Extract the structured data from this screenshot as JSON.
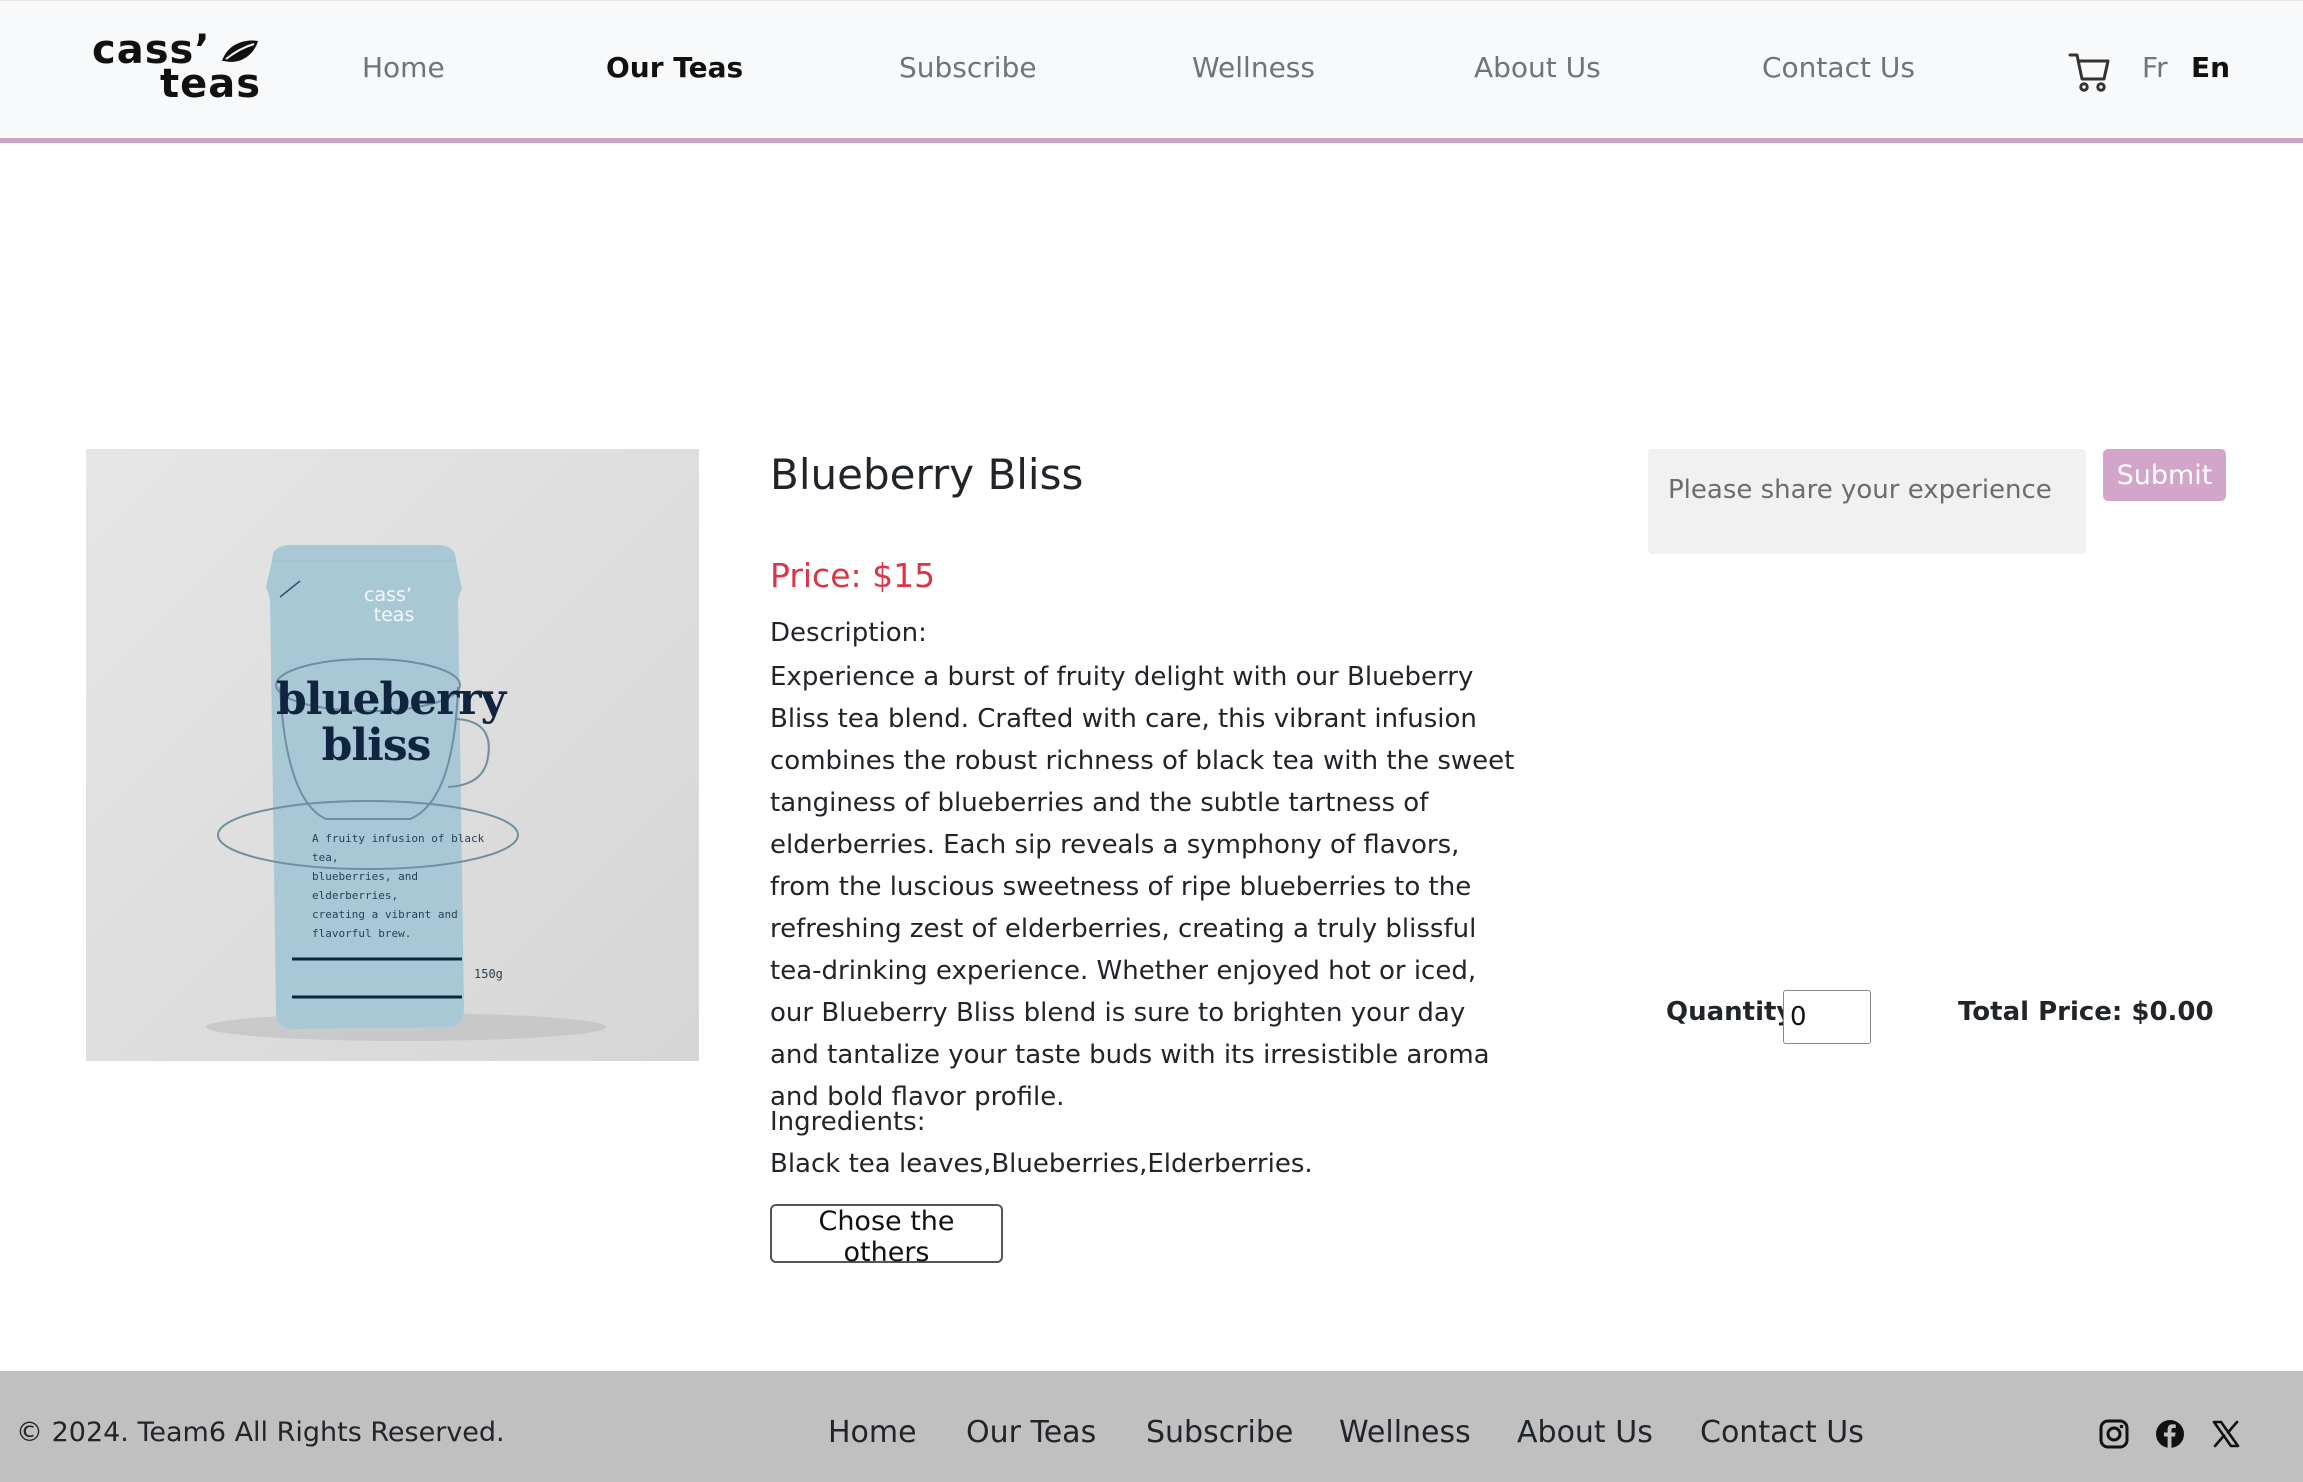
{
  "header": {
    "logo": {
      "line1": "cass’",
      "line2": "teas"
    },
    "nav": [
      {
        "label": "Home"
      },
      {
        "label": "Our Teas"
      },
      {
        "label": "Subscribe"
      },
      {
        "label": "Wellness"
      },
      {
        "label": "About Us"
      },
      {
        "label": "Contact Us"
      }
    ],
    "active_nav": "Our Teas",
    "cart_icon": "cart-icon",
    "languages": [
      {
        "label": "Fr"
      },
      {
        "label": "En"
      }
    ],
    "active_language": "En"
  },
  "product": {
    "name": "Blueberry Bliss",
    "price": "Price: $15",
    "description_label": "Description:",
    "description": "Experience a burst of fruity delight with our Blueberry Bliss tea blend. Crafted with care, this vibrant infusion combines the robust richness of black tea with the sweet tanginess of blueberries and the subtle tartness of elderberries. Each sip reveals a symphony of flavors, from the luscious sweetness of ripe blueberries to the refreshing zest of elderberries, creating a truly blissful tea-drinking experience. Whether enjoyed hot or iced, our Blueberry Bliss blend is sure to brighten your day and tantalize your taste buds with its irresistible aroma and bold flavor profile.",
    "ingredients_label": "Ingredients:",
    "ingredients": "Black tea leaves,Blueberries,Elderberries.",
    "other_button": "Chose the others",
    "package": {
      "brand_line1": "cass’",
      "brand_line2": "teas",
      "name_line1": "blueberry",
      "name_line2": "bliss",
      "tagline": [
        "A fruity infusion of black tea,",
        "blueberries, and elderberries,",
        "creating a vibrant and",
        "flavorful brew."
      ],
      "weight": "150g"
    }
  },
  "review": {
    "placeholder": "Please share your experience",
    "submit_label": "Submit"
  },
  "order": {
    "quantity_label": "Quantity:",
    "quantity_value": "0",
    "total_price": "Total Price: $0.00"
  },
  "footer": {
    "copyright": "© 2024. Team6 All Rights Reserved.",
    "nav": [
      {
        "label": "Home"
      },
      {
        "label": "Our Teas"
      },
      {
        "label": "Subscribe"
      },
      {
        "label": "Wellness"
      },
      {
        "label": "About Us"
      },
      {
        "label": "Contact Us"
      }
    ],
    "social_icons": [
      "instagram-icon",
      "facebook-icon",
      "x-icon"
    ]
  },
  "colors": {
    "accent": "#cfa3c6",
    "submit_bg": "#d4a5cb",
    "price": "#dc3545",
    "footer_bg": "#c0c0c0",
    "package": "#a9c8d6",
    "package_text": "#10243f"
  }
}
